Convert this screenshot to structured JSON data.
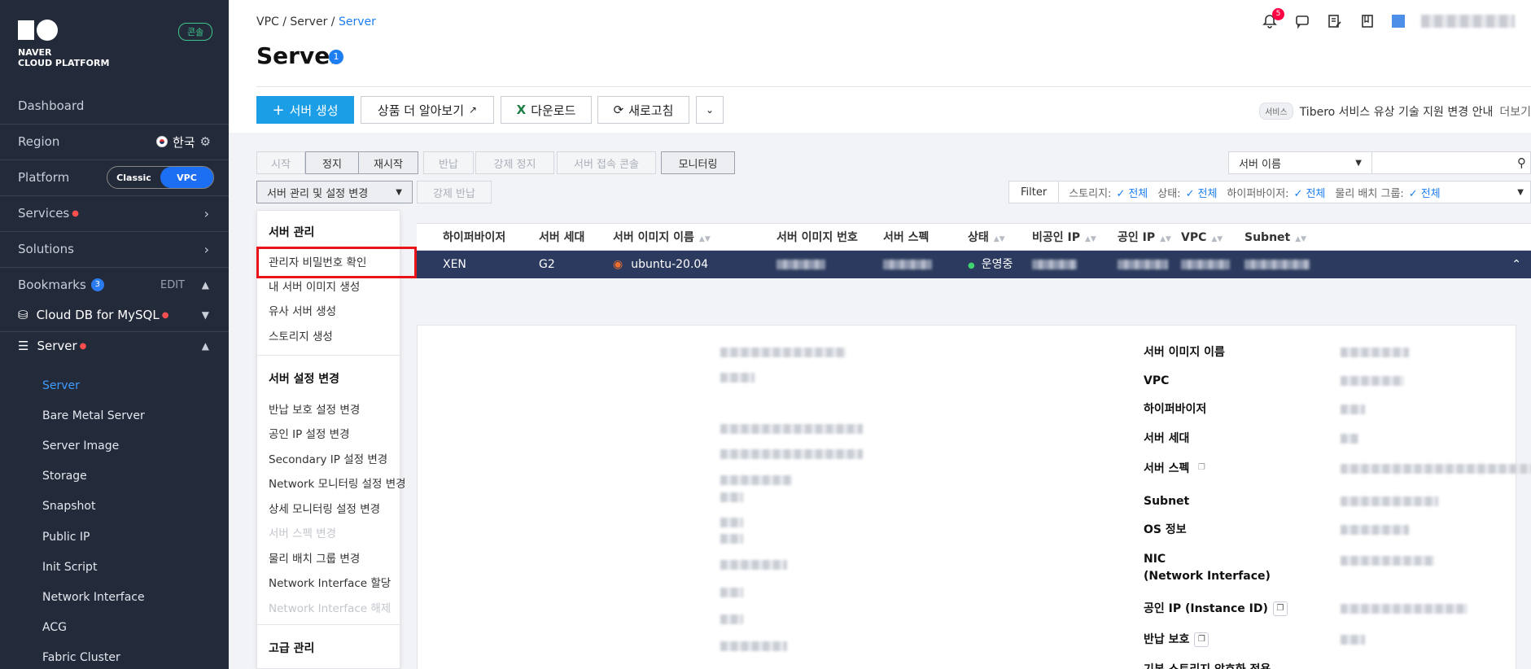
{
  "sidebar": {
    "logo_line1": "NAVER",
    "logo_line2": "CLOUD PLATFORM",
    "console_badge": "콘솔",
    "dashboard": "Dashboard",
    "region_label": "Region",
    "region_value": "한국",
    "platform_label": "Platform",
    "platform_classic": "Classic",
    "platform_vpc": "VPC",
    "services": "Services",
    "solutions": "Solutions",
    "bookmarks": "Bookmarks",
    "bookmarks_count": "3",
    "edit": "EDIT",
    "bookmark_items": [
      {
        "label": "Cloud DB for MySQL"
      },
      {
        "label": "Server"
      }
    ],
    "sub_items": [
      "Server",
      "Bare Metal Server",
      "Server Image",
      "Storage",
      "Snapshot",
      "Public IP",
      "Init Script",
      "Network Interface",
      "ACG",
      "Fabric Cluster"
    ]
  },
  "header": {
    "breadcrumb": [
      "VPC",
      "Server",
      "Server"
    ],
    "title": "Server",
    "title_count": "1",
    "notif_count": "5"
  },
  "toolbar": {
    "create": "서버 생성",
    "learn_more": "상품 더 알아보기",
    "download": "다운로드",
    "refresh": "새로고침",
    "notice_tag": "서비스",
    "notice_text": "Tibero 서비스 유상 기술 지원 변경 안내",
    "notice_more": "더보기"
  },
  "actions": {
    "start": "시작",
    "stop": "정지",
    "restart": "재시작",
    "return": "반납",
    "force_stop": "강제 정지",
    "console": "서버 접속 콘솔",
    "monitoring": "모니터링",
    "manage": "서버 관리 및 설정 변경",
    "force_return": "강제 반납"
  },
  "search": {
    "field": "서버 이름",
    "placeholder": ""
  },
  "filter": {
    "label": "Filter",
    "items": [
      {
        "name": "스토리지:",
        "value": "전체"
      },
      {
        "name": "상태:",
        "value": "전체"
      },
      {
        "name": "하이퍼바이저:",
        "value": "전체"
      },
      {
        "name": "물리 배치 그룹:",
        "value": "전체"
      }
    ]
  },
  "table": {
    "columns": [
      "하이퍼바이저",
      "서버 세대",
      "서버 이미지 이름",
      "서버 이미지 번호",
      "서버 스펙",
      "상태",
      "비공인 IP",
      "공인 IP",
      "VPC",
      "Subnet"
    ],
    "row": {
      "hypervisor": "XEN",
      "generation": "G2",
      "image": "ubuntu-20.04",
      "status": "운영중"
    }
  },
  "detail": {
    "labels": [
      "서버 이미지 이름",
      "VPC",
      "하이퍼바이저",
      "서버 세대",
      "서버 스펙",
      "Subnet",
      "OS 정보",
      "NIC",
      "(Network Interface)",
      "공인 IP (Instance ID)",
      "반납 보호",
      "기본 스토리지 암호화 적용"
    ]
  },
  "dropdown": {
    "section1": "서버 관리",
    "items1": [
      "관리자 비밀번호 확인",
      "내 서버 이미지 생성",
      "유사 서버 생성",
      "스토리지 생성"
    ],
    "section2": "서버 설정 변경",
    "items2": [
      "반납 보호 설정 변경",
      "공인 IP 설정 변경",
      "Secondary IP 설정 변경",
      "Network 모니터링 설정 변경",
      "상세 모니터링 설정 변경",
      "서버 스펙 변경",
      "물리 배치 그룹 변경",
      "Network Interface 할당",
      "Network Interface 해제"
    ],
    "section3": "고급 관리"
  }
}
